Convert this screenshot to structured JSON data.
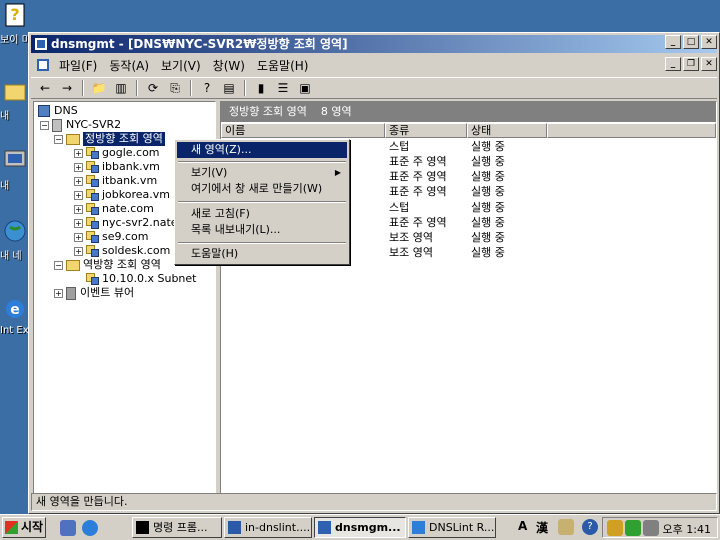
{
  "colors": {
    "desktop": "#3a6ea5",
    "title_active": "#0a246a",
    "selection": "#0a246a",
    "face": "#d4d0c8"
  },
  "desktop": {
    "icons": [
      {
        "name": "help-icon",
        "label": "보이 미"
      },
      {
        "name": "my-docs-icon",
        "label": "내"
      },
      {
        "name": "my-computer-icon",
        "label": "내 "
      },
      {
        "name": "network-icon",
        "label": "내 네"
      },
      {
        "name": "ie-icon",
        "label": "Int Ex"
      }
    ]
  },
  "window": {
    "title": "dnsmgmt - [DNS₩NYC-SVR2₩정방향 조회 영역]",
    "menu": [
      "파일(F)",
      "동작(A)",
      "보기(V)",
      "창(W)",
      "도움말(H)"
    ]
  },
  "tree": {
    "root": "DNS",
    "server": "NYC-SVR2",
    "forward_zone": "정방향 조회 영역",
    "zones": [
      "gogle.com",
      "ibbank.vm",
      "itbank.vm",
      "jobkorea.vm",
      "nate.com",
      "nyc-svr2.nate",
      "se9.com",
      "soldesk.com"
    ],
    "reverse_zone": "역방향 조회 영역",
    "reverse_child": "10.10.0.x Subnet",
    "event_viewer": "이벤트 뷰어"
  },
  "list": {
    "header_title": "정방향 조회 영역",
    "header_count": "8 영역",
    "columns": [
      "이름",
      "종류",
      "상태"
    ],
    "rows": [
      {
        "type": "스텁",
        "status": "실행 중"
      },
      {
        "type": "표준 주 영역",
        "status": "실행 중"
      },
      {
        "type": "표준 주 영역",
        "status": "실행 중"
      },
      {
        "type": "표준 주 영역",
        "status": "실행 중"
      },
      {
        "type": "스텁",
        "status": "실행 중"
      },
      {
        "type": "표준 주 영역",
        "status": "실행 중"
      },
      {
        "type": "보조 영역",
        "status": "실행 중"
      },
      {
        "type": "보조 영역",
        "status": "실행 중"
      }
    ]
  },
  "context_menu": {
    "new_zone": "새 영역(Z)...",
    "view": "보기(V)",
    "new_window": "여기에서 창 새로 만들기(W)",
    "refresh": "새로 고침(F)",
    "export": "목록 내보내기(L)...",
    "help": "도움말(H)"
  },
  "status_text": "새 영역을 만듭니다.",
  "taskbar": {
    "start": "시작",
    "tasks": [
      "명령 프롬...",
      "in-dnslint....",
      "dnsmgm...",
      "DNSLint R..."
    ],
    "ime": [
      "A",
      "漢"
    ],
    "clock": "오후 1:41"
  }
}
